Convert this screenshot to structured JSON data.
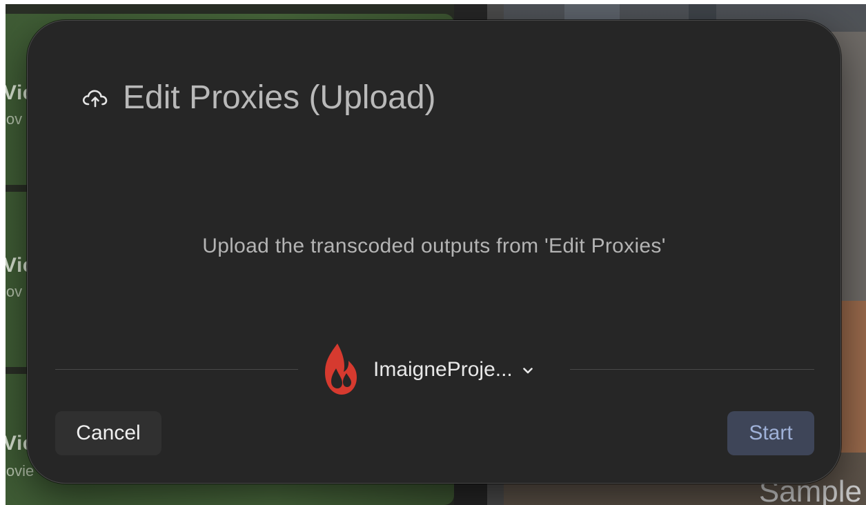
{
  "background": {
    "cards": [
      {
        "title": "Vic",
        "subtitle": "lov"
      },
      {
        "title": "Vic",
        "subtitle": "lov"
      },
      {
        "title": "Vic",
        "subtitle": "lovie"
      }
    ],
    "sample_label": "Sample"
  },
  "dialog": {
    "icon": "cloud-upload-icon",
    "title": "Edit Proxies (Upload)",
    "description": "Upload the transcoded outputs from 'Edit Proxies'",
    "project": {
      "logo": "backblaze-flame-logo",
      "name": "ImaigneProje...",
      "chevron": "chevron-down-icon"
    },
    "cancel_label": "Cancel",
    "start_label": "Start",
    "colors": {
      "title": "#b9b9b9",
      "start_text": "#9fb1d8",
      "start_bg": "#3e4558",
      "logo": "#d63a2f"
    }
  }
}
